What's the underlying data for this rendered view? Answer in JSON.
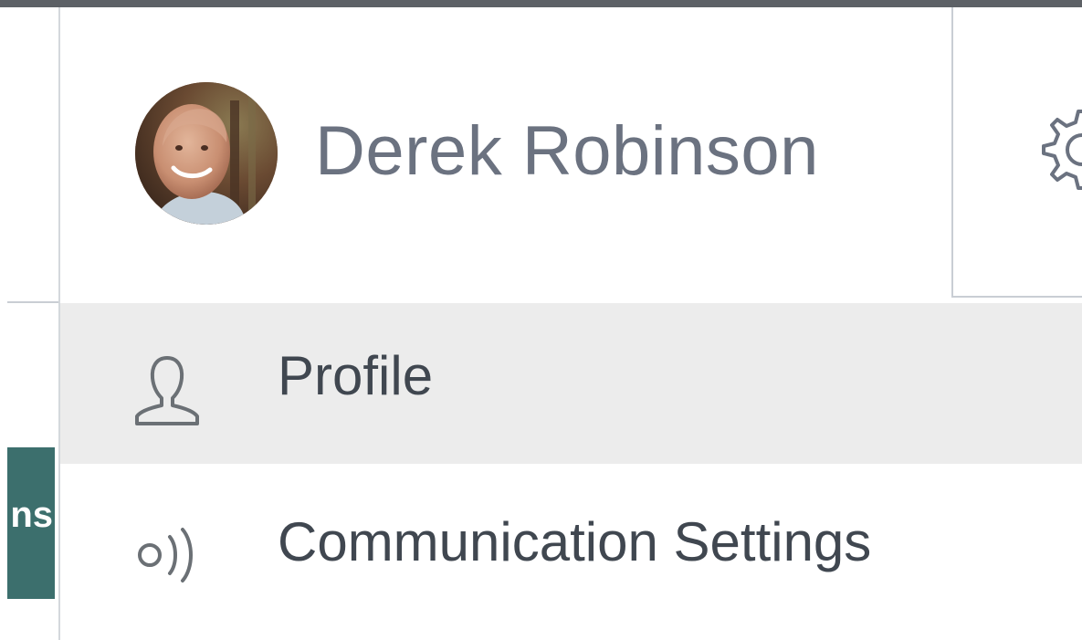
{
  "user": {
    "name": "Derek Robinson",
    "avatar_icon": "user-avatar-photo"
  },
  "header": {
    "settings_icon": "gear-icon"
  },
  "menu": {
    "items": [
      {
        "label": "Profile",
        "icon": "user-outline-icon"
      },
      {
        "label": "Communication Settings",
        "icon": "broadcast-signal-icon"
      }
    ]
  },
  "background": {
    "button_fragment": "ns"
  },
  "colors": {
    "name_text": "#6b7280",
    "menu_text": "#404750",
    "hover_bg": "#ececec",
    "teal": "#3c6f6d"
  }
}
